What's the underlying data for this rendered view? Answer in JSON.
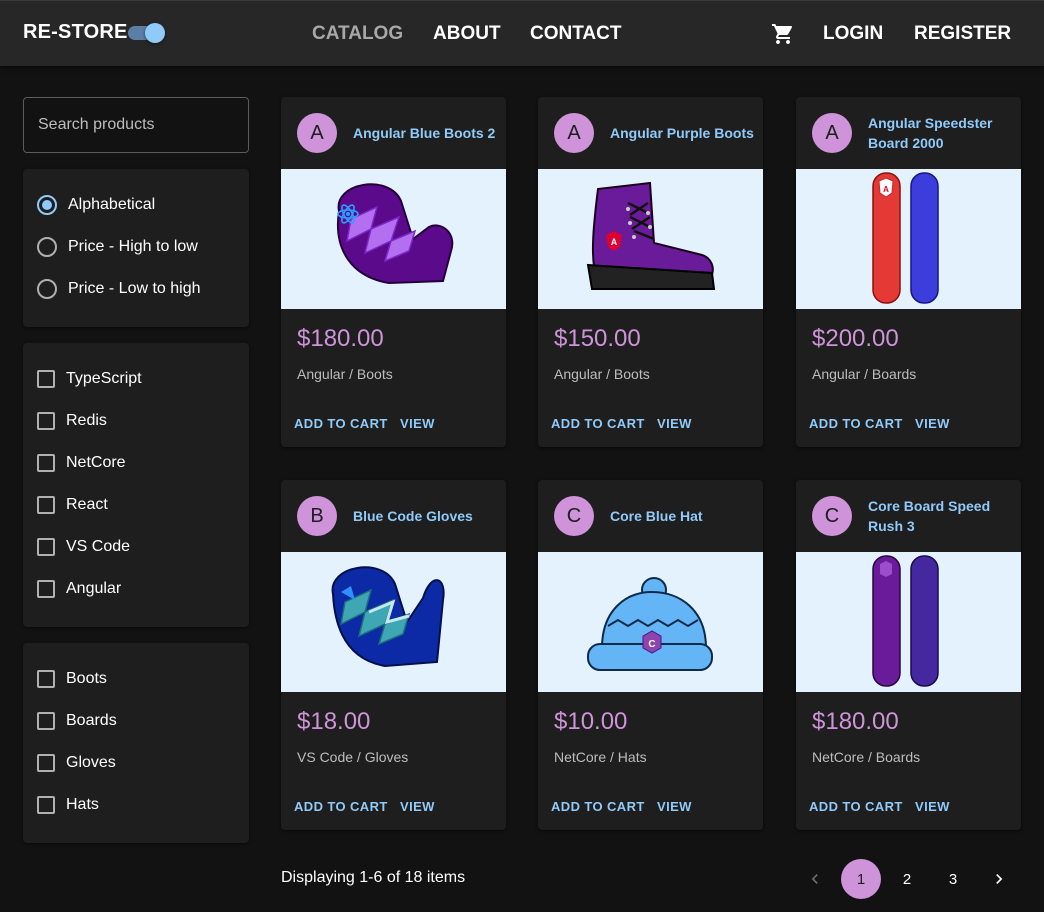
{
  "app": {
    "brand": "RE-STORE",
    "dark_mode": true
  },
  "nav": {
    "links": [
      "CATALOG",
      "ABOUT",
      "CONTACT"
    ],
    "active": "CATALOG",
    "right": [
      "LOGIN",
      "REGISTER"
    ],
    "cart_icon": "shopping-cart-icon"
  },
  "filters": {
    "search_placeholder": "Search products",
    "sort_options": [
      "Alphabetical",
      "Price - High to low",
      "Price - Low to high"
    ],
    "sort_selected": "Alphabetical",
    "brands": [
      "TypeScript",
      "Redis",
      "NetCore",
      "React",
      "VS Code",
      "Angular"
    ],
    "types": [
      "Boots",
      "Boards",
      "Gloves",
      "Hats"
    ]
  },
  "products": [
    {
      "avatar": "A",
      "name": "Angular Blue Boots 2",
      "price": "$180.00",
      "meta": "Angular / Boots",
      "image": "purple-mitten-react-logo"
    },
    {
      "avatar": "A",
      "name": "Angular Purple Boots",
      "price": "$150.00",
      "meta": "Angular / Boots",
      "image": "purple-boot-angular-logo"
    },
    {
      "avatar": "A",
      "name": "Angular Speedster Board 2000",
      "price": "$200.00",
      "meta": "Angular / Boards",
      "image": "red-blue-snowboards"
    },
    {
      "avatar": "B",
      "name": "Blue Code Gloves",
      "price": "$18.00",
      "meta": "VS Code / Gloves",
      "image": "blue-mitten-vscode-logo"
    },
    {
      "avatar": "C",
      "name": "Core Blue Hat",
      "price": "$10.00",
      "meta": "NetCore / Hats",
      "image": "blue-beanie-csharp-logo"
    },
    {
      "avatar": "C",
      "name": "Core Board Speed Rush 3",
      "price": "$180.00",
      "meta": "NetCore / Boards",
      "image": "purple-snowboards"
    }
  ],
  "card_actions": {
    "add": "ADD TO CART",
    "view": "VIEW"
  },
  "pagination": {
    "summary": "Displaying 1-6 of 18 items",
    "pages": [
      "1",
      "2",
      "3"
    ],
    "current": "1",
    "prev_icon": "chevron-left-icon",
    "next_icon": "chevron-right-icon"
  },
  "colors": {
    "accent": "#90caf9",
    "secondary": "#ce93d8",
    "background": "#121212",
    "paper": "#1e1e1e",
    "appbar": "#272727"
  }
}
